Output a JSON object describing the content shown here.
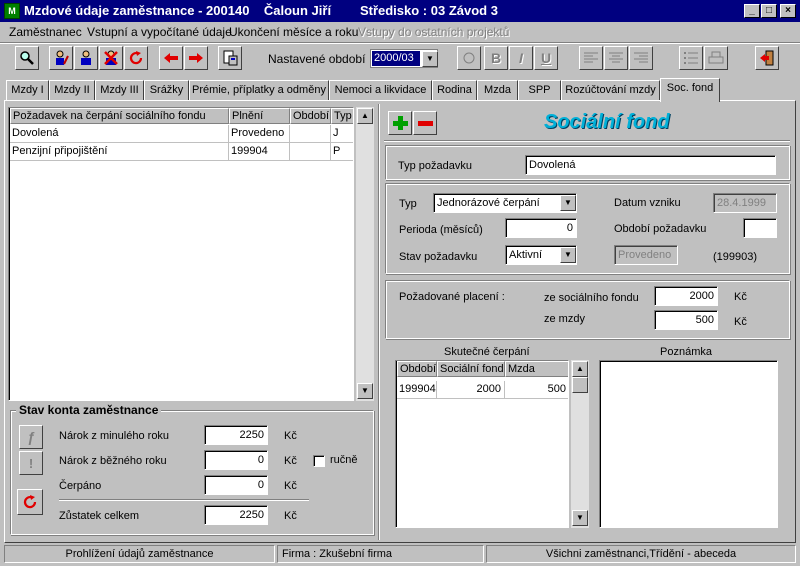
{
  "window": {
    "title": "Mzdové údaje zaměstnance - 200140    Čaloun Jiří        Středisko : 03 Závod 3",
    "icon": "app-icon",
    "minimize": "_",
    "maximize": "□",
    "close": "×"
  },
  "menu": {
    "items": [
      "Zaměstnanec",
      "Vstupní a vypočítané údaje",
      "Ukončení měsíce a roku",
      "Vstupy do ostatních projektů"
    ]
  },
  "toolbar": {
    "period_label": "Nastavené období",
    "period_value": "2000/03",
    "bold": "B",
    "italic": "I",
    "underline": "U"
  },
  "tabs": [
    "Mzdy I",
    "Mzdy II",
    "Mzdy III",
    "Srážky",
    "Prémie, příplatky a odměny",
    "Nemoci a likvidace",
    "Rodina",
    "Mzda",
    "SPP",
    "Rozúčtování mzdy",
    "Soc. fond"
  ],
  "requests_table": {
    "columns": [
      "Požadavek na čerpání sociálního fondu",
      "Plnění",
      "Období",
      "Typ"
    ],
    "rows": [
      [
        "Dovolená",
        "Provedeno",
        "",
        "J"
      ],
      [
        "Penzijní připojištění",
        "199904",
        "",
        "P"
      ]
    ]
  },
  "account": {
    "title": "Stav konta zaměstnance",
    "claim_prev_label": "Nárok z minulého roku",
    "claim_prev_value": "2250",
    "claim_curr_label": "Nárok z běžného roku",
    "claim_curr_value": "0",
    "manual_label": "ručně",
    "drawn_label": "Čerpáno",
    "drawn_value": "0",
    "balance_label": "Zůstatek celkem",
    "balance_value": "2250",
    "currency": "Kč"
  },
  "social_fund": {
    "heading": "Sociální fond",
    "request_type_label": "Typ požadavku",
    "request_type_value": "Dovolená",
    "type_label": "Typ",
    "type_value": "Jednorázové čerpání",
    "created_label": "Datum vzniku",
    "created_value": "28.4.1999",
    "period_months_label": "Perioda (měsíců)",
    "period_months_value": "0",
    "request_period_label": "Období požadavku",
    "request_period_value": "",
    "status_label": "Stav požadavku",
    "status_value": "Aktivní",
    "status_done_value": "Provedeno",
    "status_period_value": "(199903)",
    "payment_label": "Požadované placení :",
    "from_fund_label": "ze sociálního fondu",
    "from_fund_value": "2000",
    "from_wage_label": "ze mzdy",
    "from_wage_value": "500",
    "currency": "Kč"
  },
  "actual": {
    "title": "Skutečné čerpání",
    "columns": [
      "Období",
      "Sociální fond",
      "Mzda"
    ],
    "rows": [
      [
        "199904",
        "2000",
        "500"
      ]
    ]
  },
  "note": {
    "title": "Poznámka"
  },
  "status": {
    "left": "Prohlížení údajů zaměstnance",
    "middle": "Firma :  Zkušební firma",
    "right": "Všichni zaměstnanci,Třídění - abeceda"
  }
}
